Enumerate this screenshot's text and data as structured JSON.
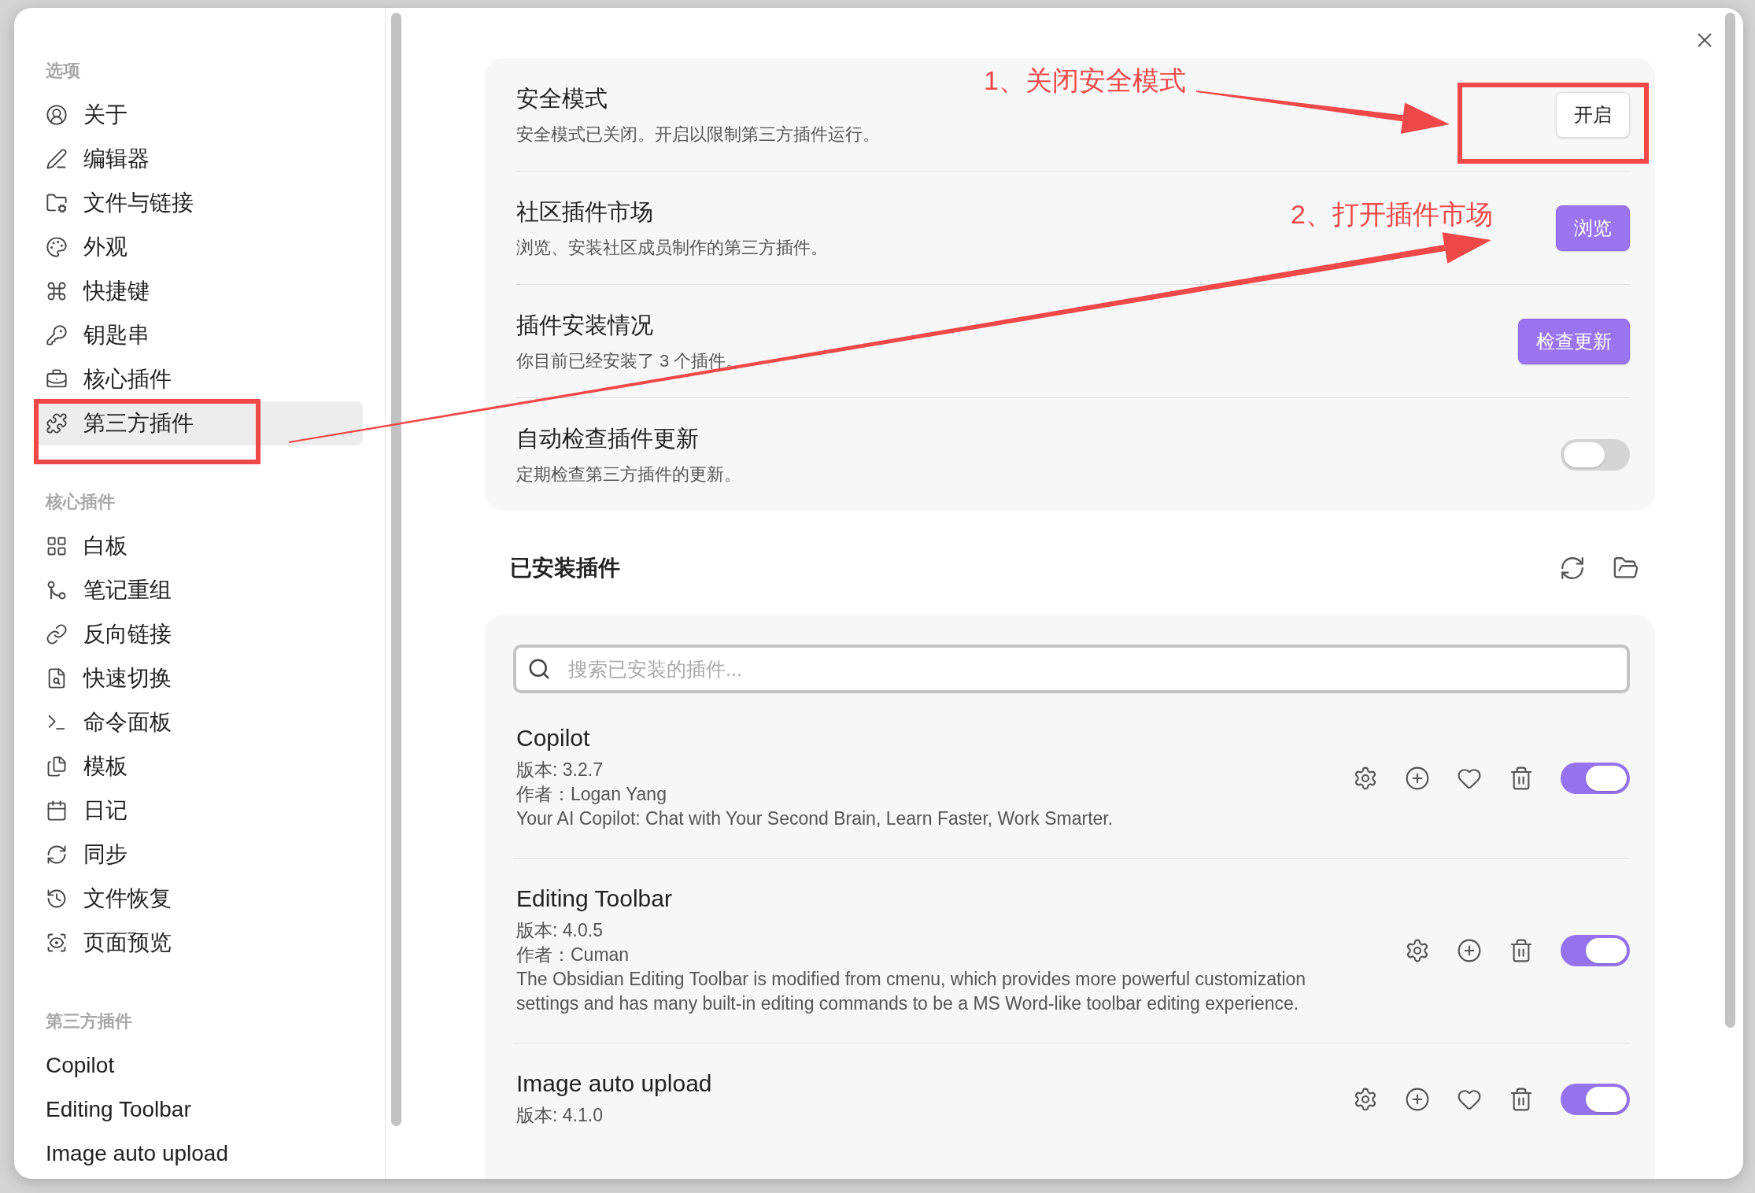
{
  "sidebar": {
    "sections": [
      {
        "heading": "选项",
        "items": [
          {
            "label": "关于",
            "selected": false
          },
          {
            "label": "编辑器",
            "selected": false
          },
          {
            "label": "文件与链接",
            "selected": false
          },
          {
            "label": "外观",
            "selected": false
          },
          {
            "label": "快捷键",
            "selected": false
          },
          {
            "label": "钥匙串",
            "selected": false
          },
          {
            "label": "核心插件",
            "selected": false
          },
          {
            "label": "第三方插件",
            "selected": true
          }
        ]
      },
      {
        "heading": "核心插件",
        "items": [
          {
            "label": "白板",
            "selected": false
          },
          {
            "label": "笔记重组",
            "selected": false
          },
          {
            "label": "反向链接",
            "selected": false
          },
          {
            "label": "快速切换",
            "selected": false
          },
          {
            "label": "命令面板",
            "selected": false
          },
          {
            "label": "模板",
            "selected": false
          },
          {
            "label": "日记",
            "selected": false
          },
          {
            "label": "同步",
            "selected": false
          },
          {
            "label": "文件恢复",
            "selected": false
          },
          {
            "label": "页面预览",
            "selected": false
          }
        ]
      },
      {
        "heading": "第三方插件",
        "items": [
          {
            "label": "Copilot",
            "selected": false
          },
          {
            "label": "Editing Toolbar",
            "selected": false
          },
          {
            "label": "Image auto upload",
            "selected": false
          }
        ]
      }
    ]
  },
  "settings": [
    {
      "title": "安全模式",
      "description": "安全模式已关闭。开启以限制第三方插件运行。",
      "control": {
        "kind": "button",
        "label": "开启"
      }
    },
    {
      "title": "社区插件市场",
      "description": "浏览、安装社区成员制作的第三方插件。",
      "control": {
        "kind": "accent-button",
        "label": "浏览"
      }
    },
    {
      "title": "插件安装情况",
      "description": "你目前已经安装了 3 个插件。",
      "control": {
        "kind": "accent-button",
        "label": "检查更新"
      }
    },
    {
      "title": "自动检查插件更新",
      "description": "定期检查第三方插件的更新。",
      "control": {
        "kind": "toggle",
        "on": false
      }
    }
  ],
  "installed": {
    "heading": "已安装插件",
    "search": {
      "placeholder": "搜索已安装的插件..."
    },
    "plugins": [
      {
        "name": "Copilot",
        "lines": [
          "版本: 3.2.7",
          "作者：Logan Yang",
          "Your AI Copilot: Chat with Your Second Brain, Learn Faster, Work Smarter."
        ],
        "actions": [
          {
            "kind": "settings"
          },
          {
            "kind": "add"
          },
          {
            "kind": "favorite"
          },
          {
            "kind": "delete"
          }
        ],
        "on": true
      },
      {
        "name": "Editing Toolbar",
        "lines": [
          "版本: 4.0.5",
          "作者：Cuman",
          "The Obsidian Editing Toolbar is modified from cmenu, which provides more powerful customization settings and has many built-in editing commands to be a MS Word-like toolbar editing experience."
        ],
        "actions": [
          {
            "kind": "settings"
          },
          {
            "kind": "add"
          },
          {
            "kind": "delete"
          }
        ],
        "on": true
      },
      {
        "name": "Image auto upload",
        "lines": [
          "版本: 4.1.0"
        ],
        "actions": [
          {
            "kind": "settings"
          },
          {
            "kind": "add"
          },
          {
            "kind": "favorite"
          },
          {
            "kind": "delete"
          }
        ],
        "on": true
      }
    ]
  },
  "annotations": [
    {
      "text": "1、关闭安全模式"
    },
    {
      "text": "2、打开插件市场"
    }
  ]
}
